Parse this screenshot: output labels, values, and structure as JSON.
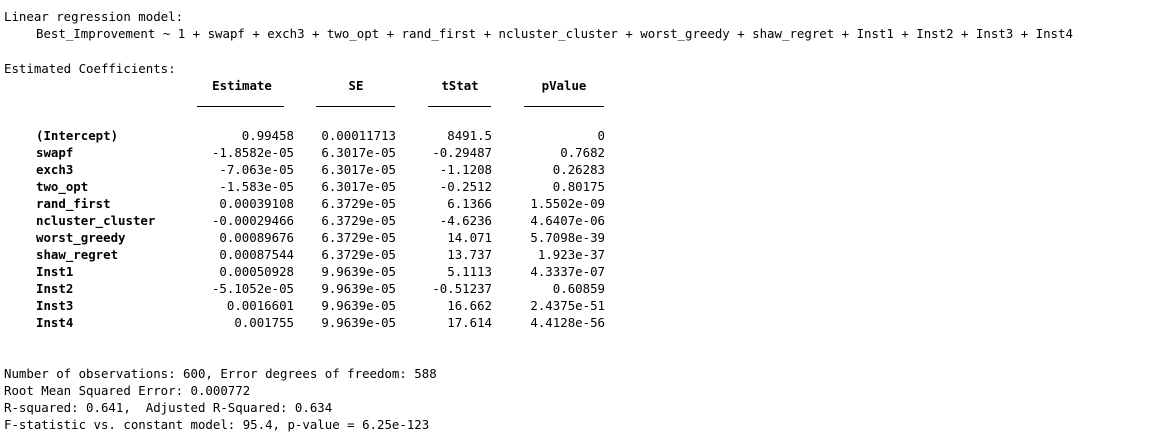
{
  "model": {
    "title": "Linear regression model:",
    "formula": "Best_Improvement ~ 1 + swapf + exch3 + two_opt + rand_first + ncluster_cluster + worst_greedy + shaw_regret + Inst1 + Inst2 + Inst3 + Inst4"
  },
  "coefficients": {
    "title": "Estimated Coefficients:",
    "headers": [
      "Estimate",
      "SE",
      "tStat",
      "pValue"
    ],
    "rows": [
      {
        "name": "(Intercept)",
        "estimate": "0.99458",
        "se": "0.00011713",
        "tstat": "8491.5",
        "pvalue": "0"
      },
      {
        "name": "swapf",
        "estimate": "-1.8582e-05",
        "se": "6.3017e-05",
        "tstat": "-0.29487",
        "pvalue": "0.7682"
      },
      {
        "name": "exch3",
        "estimate": "-7.063e-05",
        "se": "6.3017e-05",
        "tstat": "-1.1208",
        "pvalue": "0.26283"
      },
      {
        "name": "two_opt",
        "estimate": "-1.583e-05",
        "se": "6.3017e-05",
        "tstat": "-0.2512",
        "pvalue": "0.80175"
      },
      {
        "name": "rand_first",
        "estimate": "0.00039108",
        "se": "6.3729e-05",
        "tstat": "6.1366",
        "pvalue": "1.5502e-09"
      },
      {
        "name": "ncluster_cluster",
        "estimate": "-0.00029466",
        "se": "6.3729e-05",
        "tstat": "-4.6236",
        "pvalue": "4.6407e-06"
      },
      {
        "name": "worst_greedy",
        "estimate": "0.00089676",
        "se": "6.3729e-05",
        "tstat": "14.071",
        "pvalue": "5.7098e-39"
      },
      {
        "name": "shaw_regret",
        "estimate": "0.00087544",
        "se": "6.3729e-05",
        "tstat": "13.737",
        "pvalue": "1.923e-37"
      },
      {
        "name": "Inst1",
        "estimate": "0.00050928",
        "se": "9.9639e-05",
        "tstat": "5.1113",
        "pvalue": "4.3337e-07"
      },
      {
        "name": "Inst2",
        "estimate": "-5.1052e-05",
        "se": "9.9639e-05",
        "tstat": "-0.51237",
        "pvalue": "0.60859"
      },
      {
        "name": "Inst3",
        "estimate": "0.0016601",
        "se": "9.9639e-05",
        "tstat": "16.662",
        "pvalue": "2.4375e-51"
      },
      {
        "name": "Inst4",
        "estimate": "0.001755",
        "se": "9.9639e-05",
        "tstat": "17.614",
        "pvalue": "4.4128e-56"
      }
    ]
  },
  "summary": {
    "observations": "Number of observations: 600, Error degrees of freedom: 588",
    "rmse": "Root Mean Squared Error: 0.000772",
    "rsquared": "R-squared: 0.641,  Adjusted R-Squared: 0.634",
    "fstat": "F-statistic vs. constant model: 95.4, p-value = 6.25e-123"
  }
}
